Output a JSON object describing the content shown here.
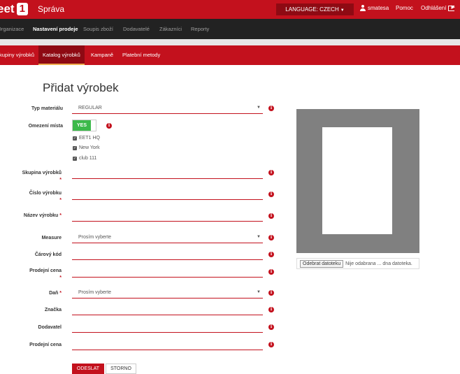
{
  "header": {
    "logo_text": "eet",
    "logo_number": "1",
    "title": "Správa",
    "language_label": "LANGUAGE: CZECH",
    "username": "smatesa",
    "help_label": "Pomoc",
    "logout_label": "Odhlášení"
  },
  "main_nav": [
    {
      "label": "Organizace",
      "active": false
    },
    {
      "label": "Nastavení prodeje",
      "active": true
    },
    {
      "label": "Soupis zboží",
      "active": false
    },
    {
      "label": "Dodavatelé",
      "active": false
    },
    {
      "label": "Zákazníci",
      "active": false
    },
    {
      "label": "Reporty",
      "active": false
    }
  ],
  "sub_nav": [
    {
      "label": "Skupiny výrobků",
      "active": false
    },
    {
      "label": "Katalog výrobků",
      "active": true
    },
    {
      "label": "Kampaně",
      "active": false
    },
    {
      "label": "Platební metody",
      "active": false
    }
  ],
  "page_title": "Přidat výrobek",
  "form": {
    "material_type": {
      "label": "Typ materiálu",
      "value": "REGULAR"
    },
    "locations": {
      "label": "Omezení místa",
      "toggle_label": "YES",
      "options": [
        {
          "label": "EET1 HQ",
          "checked": true
        },
        {
          "label": "New York",
          "checked": true
        },
        {
          "label": "club 111",
          "checked": true
        }
      ]
    },
    "product_group": {
      "label": "Skupina výrobků",
      "required": "*",
      "value": ""
    },
    "product_number": {
      "label": "Číslo výrobku",
      "required": "*",
      "value": ""
    },
    "product_name": {
      "label": "Název výrobku",
      "required": "*",
      "value": ""
    },
    "measure": {
      "label": "Measure",
      "placeholder": "Prosím vyberte"
    },
    "barcode": {
      "label": "Čárový kód",
      "value": ""
    },
    "sale_price": {
      "label": "Prodejní cena",
      "required": "*",
      "value": ""
    },
    "tax": {
      "label": "Daň",
      "required": "*",
      "placeholder": "Prosím vyberte"
    },
    "brand": {
      "label": "Značka",
      "value": ""
    },
    "supplier": {
      "label": "Dodavatel",
      "value": ""
    },
    "sale_price_2": {
      "label": "Prodejní cena",
      "value": ""
    },
    "submit_label": "ODESLAT",
    "cancel_label": "STORNO"
  },
  "file_upload": {
    "button_label": "Odebrat datoteku",
    "status_text": "Nije odabrana ... dna datoteka."
  },
  "info_glyph": "i",
  "colors": {
    "brand_red": "#c3111d",
    "dark_nav": "#222222",
    "toggle_green": "#3cb94a"
  }
}
